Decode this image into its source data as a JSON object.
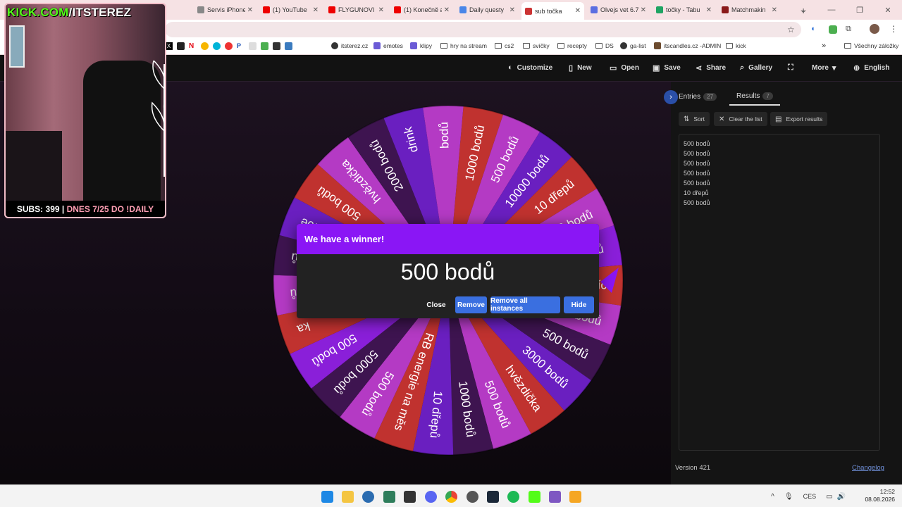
{
  "browser": {
    "tabs": [
      {
        "title": "Servis iPhone",
        "color": "#888"
      },
      {
        "title": "(1) YouTube",
        "color": "#e00"
      },
      {
        "title": "FLYGUNOVI a",
        "color": "#e00"
      },
      {
        "title": "(1) Konečně a",
        "color": "#e00"
      },
      {
        "title": "Daily questy",
        "color": "#4a86e8"
      },
      {
        "title": "sub točka",
        "color": "#c33",
        "active": true
      },
      {
        "title": "Olvejs vet 6.7",
        "color": "#5b6ee1"
      },
      {
        "title": "točky - Tabu",
        "color": "#1fa463"
      },
      {
        "title": "Matchmakin",
        "color": "#8a1a1a"
      }
    ],
    "new_tab": "+",
    "win_controls": [
      "⌄",
      "—",
      "❐",
      "✕"
    ],
    "bookmarks": [
      {
        "label": "itsterez.cz",
        "icon": "globe-icon"
      },
      {
        "label": "emotes",
        "icon": "sl-icon"
      },
      {
        "label": "klipy",
        "icon": "sl-icon"
      },
      {
        "label": "hry na stream",
        "icon": "folder-icon"
      },
      {
        "label": "cs2",
        "icon": "folder-icon"
      },
      {
        "label": "svíčky",
        "icon": "folder-icon"
      },
      {
        "label": "recepty",
        "icon": "folder-icon"
      },
      {
        "label": "DS",
        "icon": "folder-icon"
      },
      {
        "label": "ga-list",
        "icon": "globe-icon"
      },
      {
        "label": "itscandles.cz -ADMIN",
        "icon": "site-icon"
      },
      {
        "label": "kick",
        "icon": "folder-icon"
      }
    ],
    "bookmark_overflow": "»",
    "all_bookmarks": "Všechny záložky"
  },
  "toolbar": {
    "items": [
      {
        "label": "Customize",
        "icon": "palette-icon"
      },
      {
        "label": "New",
        "icon": "new-file-icon"
      },
      {
        "label": "Open",
        "icon": "folder-open-icon"
      },
      {
        "label": "Save",
        "icon": "save-icon"
      },
      {
        "label": "Share",
        "icon": "share-icon"
      },
      {
        "label": "Gallery",
        "icon": "search-icon"
      },
      {
        "label": "",
        "icon": "fullscreen-icon"
      },
      {
        "label": "More",
        "icon": "chevron-down-icon"
      },
      {
        "label": "English",
        "icon": "globe-icon"
      }
    ]
  },
  "stream_overlay": {
    "site": "KICK.COM",
    "channel": "/ITSTEREZ",
    "subs_text": "SUBS: 399 | ",
    "daily_text": "DNES 7/25 DO !DAILY"
  },
  "wheel": {
    "segments": [
      {
        "label": "1000 bodů",
        "color": "#c0322f"
      },
      {
        "label": "500 bodů",
        "color": "#b43ac4"
      },
      {
        "label": "10000 bodů",
        "color": "#6a1fc0"
      },
      {
        "label": "10 dřepů",
        "color": "#c0322f"
      },
      {
        "label": "1000 bodů",
        "color": "#b43ac4"
      },
      {
        "label": "500 bodů",
        "color": "#8a1fd9"
      },
      {
        "label": "měsíc",
        "color": "#c0322f"
      },
      {
        "label": "1000 bodů",
        "color": "#b43ac4"
      },
      {
        "label": "500 bodů",
        "color": "#3e1450"
      },
      {
        "label": "3000 bodů",
        "color": "#6a1fc0"
      },
      {
        "label": "hvězdička",
        "color": "#c0322f"
      },
      {
        "label": "500 bodů",
        "color": "#b43ac4"
      },
      {
        "label": "1000 bodů",
        "color": "#3e1450"
      },
      {
        "label": "10 dřepů",
        "color": "#6a1fc0"
      },
      {
        "label": "RB energie na měs",
        "color": "#c0322f"
      },
      {
        "label": "500 bodů",
        "color": "#b43ac4"
      },
      {
        "label": "5000 bodů",
        "color": "#3e1450"
      },
      {
        "label": "500 bodů",
        "color": "#8a1fd9"
      },
      {
        "label": "ka",
        "color": "#c0322f"
      },
      {
        "label": "bodů",
        "color": "#b43ac4"
      },
      {
        "label": "500 bodů",
        "color": "#3e1450"
      },
      {
        "label": "skin na AK za 40e",
        "color": "#6a1fc0"
      },
      {
        "label": "500 bodů",
        "color": "#c0322f"
      },
      {
        "label": "hvězdička",
        "color": "#b43ac4"
      },
      {
        "label": "2000 bodů",
        "color": "#3e1450"
      },
      {
        "label": "drink",
        "color": "#6a1fc0"
      },
      {
        "label": "bodů",
        "color": "#b43ac4"
      }
    ],
    "pointer_color": "#8a16f5"
  },
  "dialog": {
    "title": "We have a winner!",
    "winner": "500 bodů",
    "close": "Close",
    "remove": "Remove",
    "remove_all": "Remove all instances",
    "hide": "Hide"
  },
  "panel": {
    "entries_label": "Entries",
    "entries_count": "27",
    "results_label": "Results",
    "results_count": "7",
    "sort": "Sort",
    "clear": "Clear the list",
    "export": "Export results",
    "results": [
      "500 bodů",
      "500 bodů",
      "500 bodů",
      "500 bodů",
      "500 bodů",
      "10 dřepů",
      "500 bodů"
    ],
    "version": "Version 421",
    "changelog": "Changelog"
  },
  "taskbar": {
    "tray_lang": "CES",
    "time": "12:52",
    "date": "08.08.2026",
    "caret": "^"
  }
}
